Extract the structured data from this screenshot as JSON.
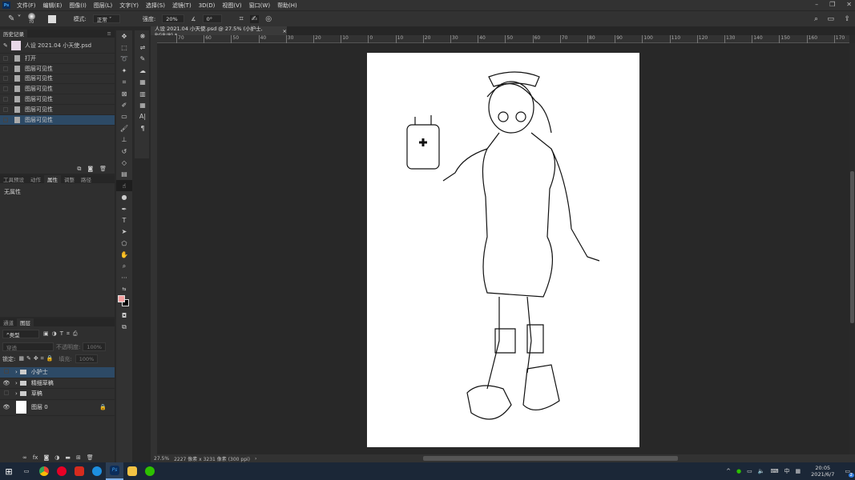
{
  "app": {
    "logo": "Ps"
  },
  "menu": [
    "文件(F)",
    "编辑(E)",
    "图像(I)",
    "图层(L)",
    "文字(Y)",
    "选择(S)",
    "滤镜(T)",
    "3D(D)",
    "视图(V)",
    "窗口(W)",
    "帮助(H)"
  ],
  "options": {
    "brush_size": "70",
    "mode_label": "模式:",
    "mode_value": "正常",
    "strength_label": "强度:",
    "strength_value": "20%",
    "angle_value": "0°"
  },
  "history": {
    "title": "历史记录",
    "snapshot": "人设 2021.04 小天使.psd",
    "items": [
      "打开",
      "图层可见性",
      "图层可见性",
      "图层可见性",
      "图层可见性",
      "图层可见性",
      "图层可见性"
    ],
    "selected_index": 6
  },
  "props": {
    "tabs": [
      "工具预设",
      "动作",
      "属性",
      "调整",
      "路径"
    ],
    "active": "属性",
    "empty_text": "无属性"
  },
  "layers_panel": {
    "tabs": [
      "通道",
      "图层"
    ],
    "active": "图层",
    "filter": "类型",
    "blend": "穿透",
    "opacity_label": "不透明度:",
    "opacity": "100%",
    "lock_label": "锁定:",
    "fill_label": "填充:",
    "fill": "100%",
    "layers": [
      {
        "name": "小护士",
        "visible": false,
        "type": "group",
        "selected": true
      },
      {
        "name": "精细草稿",
        "visible": true,
        "type": "group"
      },
      {
        "name": "草稿",
        "visible": false,
        "type": "group"
      },
      {
        "name": "图层 0",
        "visible": true,
        "type": "layer",
        "locked": true
      }
    ]
  },
  "document": {
    "tab_title": "人设 2021.04 小天使.psd @ 27.5% (小护士, RGB/8) *",
    "close": "×"
  },
  "ruler_top": [
    "70",
    "60",
    "50",
    "40",
    "30",
    "20",
    "10",
    "0",
    "10",
    "20",
    "30",
    "40",
    "50",
    "60",
    "70",
    "80",
    "90",
    "100",
    "110",
    "120",
    "130",
    "140",
    "150",
    "160",
    "170"
  ],
  "status": {
    "zoom": "27.5%",
    "info": "2227 像素 x 3231 像素 (300 ppi)",
    "arrow": "›"
  },
  "colors": {
    "foreground": "#f4a0a0",
    "background": "#000000",
    "selection": "#2d4a66"
  },
  "taskbar": {
    "time": "20:05",
    "date": "2021/6/7",
    "ime": "中",
    "notifications": "2"
  }
}
